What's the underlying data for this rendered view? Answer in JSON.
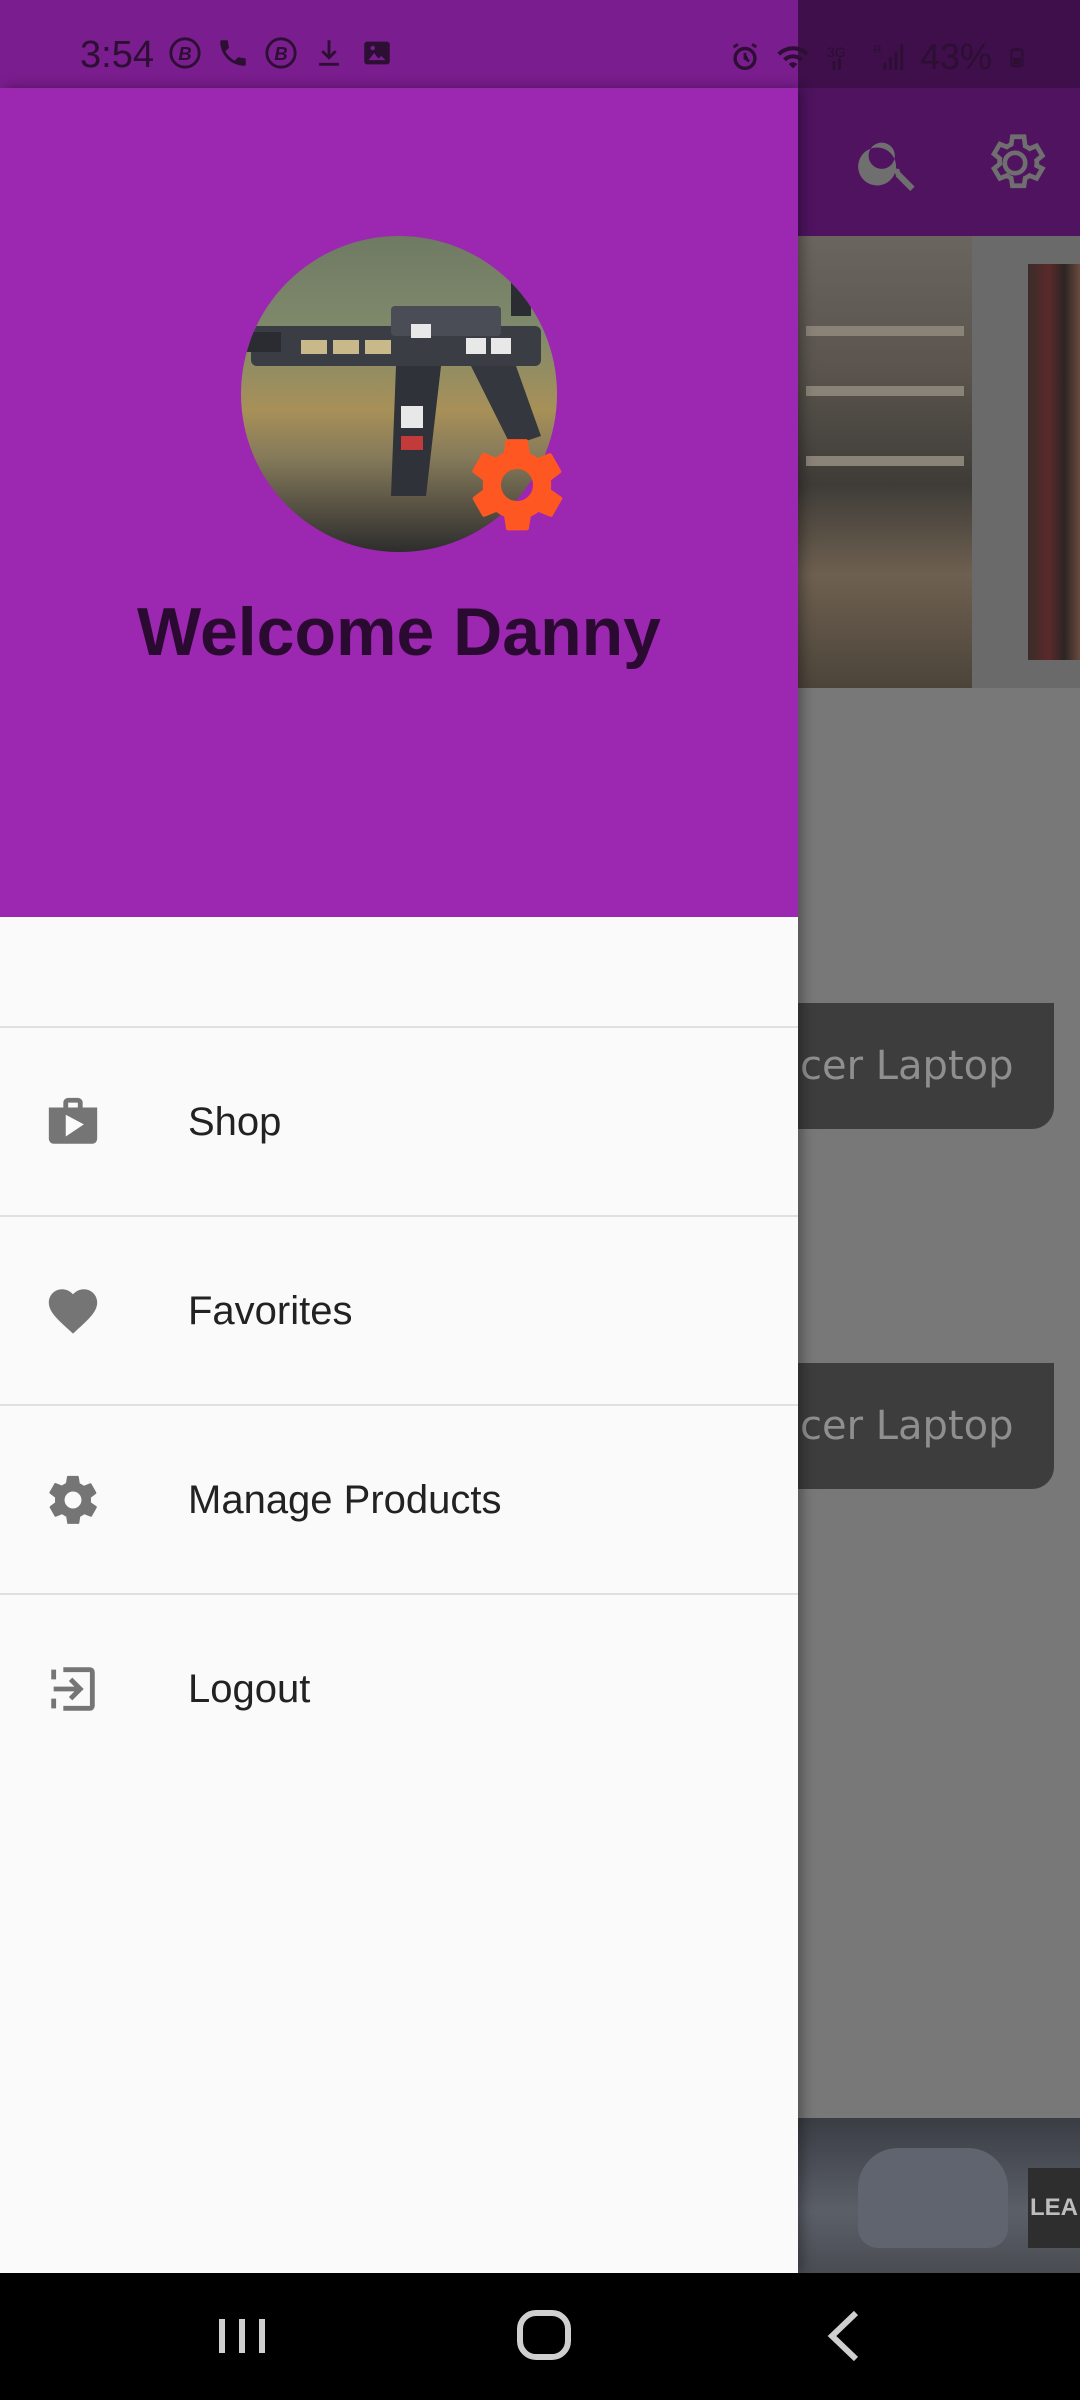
{
  "status_bar": {
    "time": "3:54",
    "battery": "43%",
    "left_icons": [
      "b-circle-icon",
      "wifi-call-icon",
      "b-circle-icon",
      "download-icon",
      "image-icon"
    ],
    "right_icons": [
      "alarm-icon",
      "wifi-icon",
      "3g-icon",
      "signal-icon",
      "battery-icon"
    ]
  },
  "drawer": {
    "welcome": "Welcome Danny",
    "menu": [
      {
        "label": "Shop",
        "icon": "shop-bag-icon"
      },
      {
        "label": "Favorites",
        "icon": "heart-icon"
      },
      {
        "label": "Manage Products",
        "icon": "gear-icon"
      },
      {
        "label": "Logout",
        "icon": "logout-icon"
      }
    ]
  },
  "background": {
    "cards": [
      "cer Laptop",
      "cer Laptop"
    ],
    "bottom_image_text": "LEA"
  },
  "colors": {
    "drawer_header": "#9c27b0",
    "settings_badge": "#ff5722",
    "icon_gray": "#757575"
  }
}
